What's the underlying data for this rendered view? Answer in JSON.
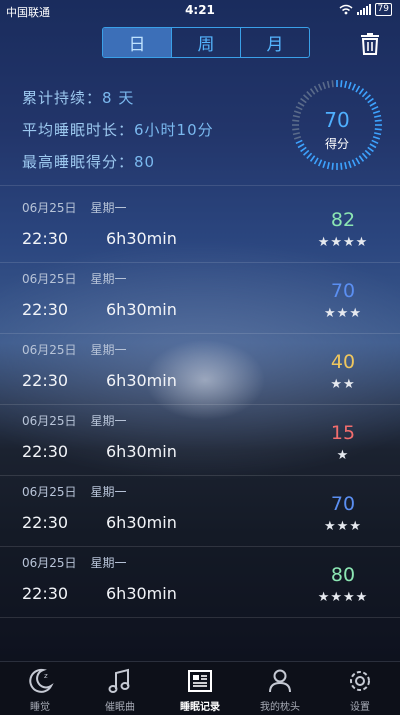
{
  "status": {
    "carrier": "中国联通",
    "time": "4:21",
    "battery": "79"
  },
  "tabs_top": [
    "日",
    "周",
    "月"
  ],
  "stats": {
    "total_label": "累计持续：",
    "total_value": "8 天",
    "avg_label": "平均睡眠时长：",
    "avg_value": "6小时10分",
    "best_label": "最高睡眠得分：",
    "best_value": "80"
  },
  "ring": {
    "value": "70",
    "label": "得分"
  },
  "records": [
    {
      "date": "06月25日",
      "weekday": "星期一",
      "time": "22:30",
      "duration": "6h30min",
      "score": "82",
      "stars": "★★★★",
      "color": "#8ce6b3"
    },
    {
      "date": "06月25日",
      "weekday": "星期一",
      "time": "22:30",
      "duration": "6h30min",
      "score": "70",
      "stars": "★★★",
      "color": "#5b8ff2"
    },
    {
      "date": "06月25日",
      "weekday": "星期一",
      "time": "22:30",
      "duration": "6h30min",
      "score": "40",
      "stars": "★★",
      "color": "#f0c75e"
    },
    {
      "date": "06月25日",
      "weekday": "星期一",
      "time": "22:30",
      "duration": "6h30min",
      "score": "15",
      "stars": "★",
      "color": "#f26d6d"
    },
    {
      "date": "06月25日",
      "weekday": "星期一",
      "time": "22:30",
      "duration": "6h30min",
      "score": "70",
      "stars": "★★★",
      "color": "#5b8ff2"
    },
    {
      "date": "06月25日",
      "weekday": "星期一",
      "time": "22:30",
      "duration": "6h30min",
      "score": "80",
      "stars": "★★★★",
      "color": "#8ce6b3"
    }
  ],
  "bottom_tabs": [
    {
      "label": "睡觉",
      "icon": "moon-icon"
    },
    {
      "label": "催眠曲",
      "icon": "music-note-icon"
    },
    {
      "label": "睡眠记录",
      "icon": "record-icon"
    },
    {
      "label": "我的枕头",
      "icon": "user-icon"
    },
    {
      "label": "设置",
      "icon": "gear-icon"
    }
  ]
}
